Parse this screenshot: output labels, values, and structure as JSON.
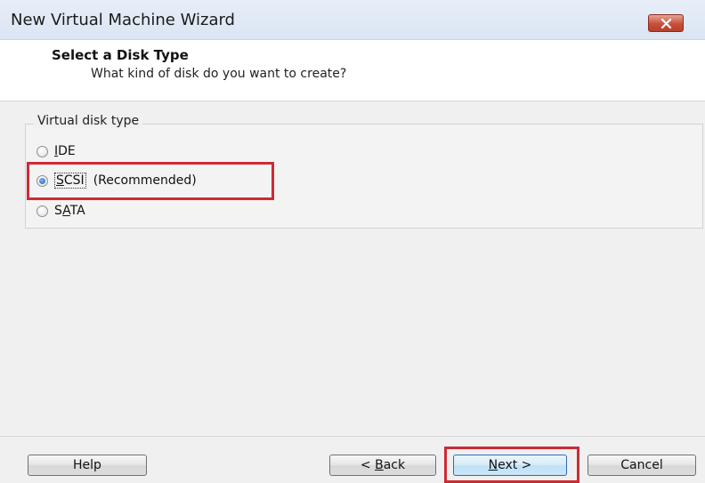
{
  "window": {
    "title": "New Virtual Machine Wizard",
    "close_icon": "close-icon"
  },
  "header": {
    "title": "Select a Disk Type",
    "subtitle": "What kind of disk do you want to create?"
  },
  "disk_group": {
    "legend": "Virtual disk type",
    "options": [
      {
        "accel": "I",
        "rest": "DE",
        "suffix": "",
        "checked": false
      },
      {
        "accel": "S",
        "rest": "CSI",
        "suffix": "(Recommended)",
        "checked": true
      },
      {
        "pre": "S",
        "accel": "A",
        "rest": "TA",
        "suffix": "",
        "checked": false
      }
    ]
  },
  "buttons": {
    "help": "Help",
    "back_prefix": "< ",
    "back_accel": "B",
    "back_rest": "ack",
    "next_accel": "N",
    "next_rest": "ext >",
    "cancel": "Cancel"
  },
  "colors": {
    "highlight": "#cc2b34",
    "title_bar": "#dbe5f3",
    "close_button": "#c7503a"
  }
}
